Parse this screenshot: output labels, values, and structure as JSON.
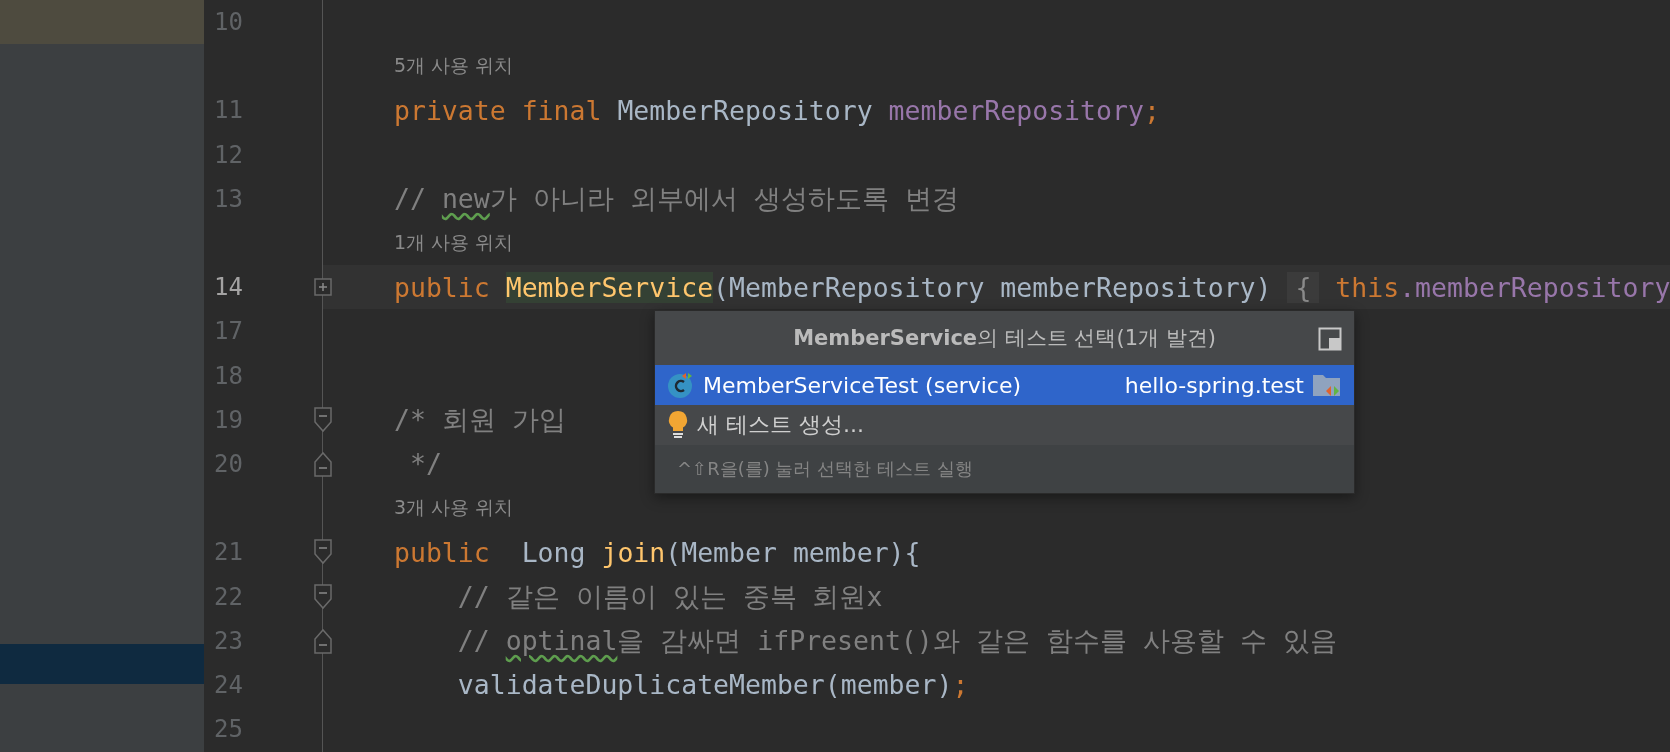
{
  "editor": {
    "lines": [
      {
        "kind": "code",
        "number": "10",
        "current": false
      },
      {
        "kind": "hint",
        "text": "5개 사용 위치"
      },
      {
        "kind": "code",
        "number": "11",
        "current": false,
        "tokens": [
          {
            "text": "private final ",
            "kind": "keyword"
          },
          {
            "text": "MemberRepository ",
            "kind": "plain"
          },
          {
            "text": "memberRepository",
            "kind": "field"
          },
          {
            "text": ";",
            "kind": "keyword"
          }
        ]
      },
      {
        "kind": "code",
        "number": "12",
        "current": false
      },
      {
        "kind": "code",
        "number": "13",
        "current": false,
        "tokens": [
          {
            "text": "// ",
            "kind": "comment"
          },
          {
            "text": "new",
            "kind": "comment-typo"
          },
          {
            "text": "가 아니라 외부에서 생성하도록 변경",
            "kind": "comment"
          }
        ]
      },
      {
        "kind": "hint",
        "text": "1개 사용 위치"
      },
      {
        "kind": "code",
        "number": "14",
        "current": true,
        "fold_marker": {
          "kind": "expand"
        },
        "tokens": [
          {
            "text": "public ",
            "kind": "keyword"
          },
          {
            "text": "MemberService",
            "kind": "method-highlighted"
          },
          {
            "text": "(MemberRepository memberRepository) ",
            "kind": "plain"
          },
          {
            "text": "{",
            "kind": "fold-placeholder"
          },
          {
            "text": " this",
            "kind": "keyword"
          },
          {
            "text": ".memberRepository",
            "kind": "field"
          }
        ]
      },
      {
        "kind": "code",
        "number": "17",
        "current": false
      },
      {
        "kind": "code",
        "number": "18",
        "current": false
      },
      {
        "kind": "code",
        "number": "19",
        "current": false,
        "fold_marker": {
          "kind": "collapse-start"
        },
        "tokens": [
          {
            "text": "/* 회원 가입",
            "kind": "comment"
          }
        ]
      },
      {
        "kind": "code",
        "number": "20",
        "current": false,
        "fold_marker": {
          "kind": "collapse-end"
        },
        "tokens": [
          {
            "text": " */",
            "kind": "comment"
          }
        ]
      },
      {
        "kind": "hint",
        "text": "3개 사용 위치"
      },
      {
        "kind": "code",
        "number": "21",
        "current": false,
        "fold_marker": {
          "kind": "collapse-start"
        },
        "tokens": [
          {
            "text": "public ",
            "kind": "keyword"
          },
          {
            "text": " Long ",
            "kind": "plain"
          },
          {
            "text": "join",
            "kind": "method"
          },
          {
            "text": "(Member member){",
            "kind": "plain"
          }
        ]
      },
      {
        "kind": "code",
        "number": "22",
        "current": false,
        "fold_marker": {
          "kind": "collapse-start"
        },
        "tokens": [
          {
            "text": "    // 같은 이름이 있는 중복 회원x",
            "kind": "comment"
          }
        ]
      },
      {
        "kind": "code",
        "number": "23",
        "current": false,
        "fold_marker": {
          "kind": "collapse-end"
        },
        "tokens": [
          {
            "text": "    // ",
            "kind": "comment"
          },
          {
            "text": "optinal",
            "kind": "comment-typo"
          },
          {
            "text": "을 감싸면 ifPresent()와 같은 함수를 사용할 수 있음",
            "kind": "comment"
          }
        ]
      },
      {
        "kind": "code",
        "number": "24",
        "current": false,
        "tokens": [
          {
            "text": "    validateDuplicateMember(member)",
            "kind": "plain"
          },
          {
            "text": ";",
            "kind": "keyword"
          }
        ]
      },
      {
        "kind": "code",
        "number": "25",
        "current": false
      }
    ]
  },
  "popup": {
    "title": "**MemberService**의 테스트 선택(1개 발견)",
    "items": [
      {
        "kind": "test",
        "label": "MemberServiceTest (service)",
        "module": "hello-spring.test",
        "selected": true
      },
      {
        "kind": "create",
        "label": "새 테스트 생성...",
        "selected": false
      }
    ],
    "footer": "^⇧R을(를) 눌러 선택한 테스트 실행"
  }
}
